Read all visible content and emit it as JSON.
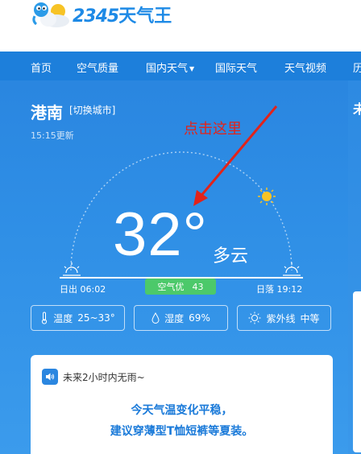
{
  "header": {
    "logo_text": "2345",
    "logo_text_zh": "天气王"
  },
  "nav": {
    "items": [
      {
        "label": "首页"
      },
      {
        "label": "空气质量"
      },
      {
        "label": "国内天气"
      },
      {
        "label": "国际天气"
      },
      {
        "label": "天气视频"
      },
      {
        "label": "历"
      }
    ]
  },
  "weather": {
    "city": "港南",
    "switch_city": "[切换城市]",
    "updated": "15:15更新",
    "temperature": "32°",
    "condition": "多云",
    "sunrise": "日出 06:02",
    "sunset": "日落 19:12",
    "aqi_label": "空气优",
    "aqi_value": "43",
    "temp_range_label": "温度",
    "temp_range": "25~33°",
    "humidity_label": "湿度",
    "humidity": "69%",
    "uv_label": "紫外线",
    "uv": "中等"
  },
  "annotation": {
    "text": "点击这里"
  },
  "side_card": {
    "edge_char": "未"
  },
  "forecast_card": {
    "rain_text": "未来2小时内无雨~",
    "tip_line1": "今天气温变化平稳，",
    "tip_line2": "建议穿薄型T恤短裤等夏装。"
  },
  "colors": {
    "brand": "#1e8ae6",
    "nav_bg": "#1d7fdb",
    "main_bg": "#2f8fe6",
    "aqi_good": "#4cc96a",
    "annotation": "#e2231a",
    "sun": "#f7c325"
  }
}
